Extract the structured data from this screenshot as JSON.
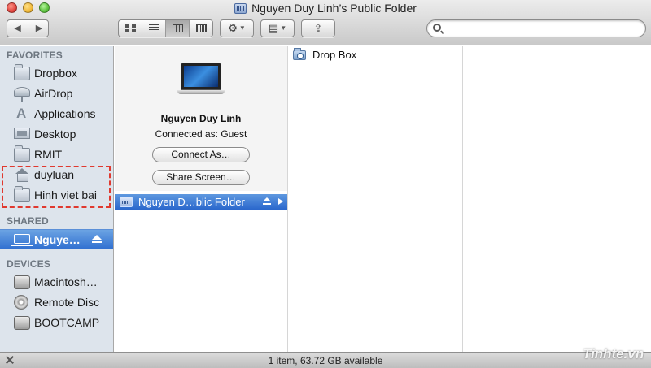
{
  "window": {
    "title": "Nguyen Duy Linh’s Public Folder",
    "title_icon": "shared-server-icon"
  },
  "toolbar": {
    "back_icon": "◀",
    "forward_icon": "▶",
    "views": [
      {
        "name": "icon-view",
        "active": false
      },
      {
        "name": "list-view",
        "active": false
      },
      {
        "name": "column-view",
        "active": true
      },
      {
        "name": "cover-flow-view",
        "active": false
      }
    ],
    "action_icon": "⚙",
    "arrange_icon": "▤",
    "share_icon": "⇪",
    "search": {
      "placeholder": "",
      "value": ""
    }
  },
  "sidebar": {
    "sections": {
      "favorites": "FAVORITES",
      "shared": "SHARED",
      "devices": "DEVICES"
    },
    "favorites": [
      {
        "label": "Dropbox",
        "icon": "folder-icon"
      },
      {
        "label": "AirDrop",
        "icon": "airdrop-icon"
      },
      {
        "label": "Applications",
        "icon": "applications-icon"
      },
      {
        "label": "Desktop",
        "icon": "desktop-icon"
      },
      {
        "label": "RMIT",
        "icon": "folder-icon"
      },
      {
        "label": "duyluan",
        "icon": "home-icon"
      },
      {
        "label": "Hinh viet bai",
        "icon": "folder-icon"
      }
    ],
    "shared": [
      {
        "label": "Nguye…",
        "icon": "laptop-icon",
        "selected": true
      }
    ],
    "devices": [
      {
        "label": "Macintosh…",
        "icon": "hard-disk-icon"
      },
      {
        "label": "Remote Disc",
        "icon": "disc-icon"
      },
      {
        "label": "BOOTCAMP",
        "icon": "hard-disk-icon"
      }
    ]
  },
  "server": {
    "name": "Nguyen Duy Linh",
    "connected_as": "Connected as: Guest",
    "connect_as_label": "Connect As…",
    "share_screen_label": "Share Screen…",
    "selected_item": "Nguyen D…blic Folder"
  },
  "column2": {
    "items": [
      {
        "label": "Drop Box",
        "icon": "drop-box-folder-icon"
      }
    ]
  },
  "statusbar": {
    "text": "1 item, 63.72 GB available"
  },
  "watermark": "Tinhte.vn",
  "colors": {
    "selection_blue": "#2f6fd0",
    "sidebar_bg": "#dde4ec",
    "highlight_red": "#e0392f"
  }
}
